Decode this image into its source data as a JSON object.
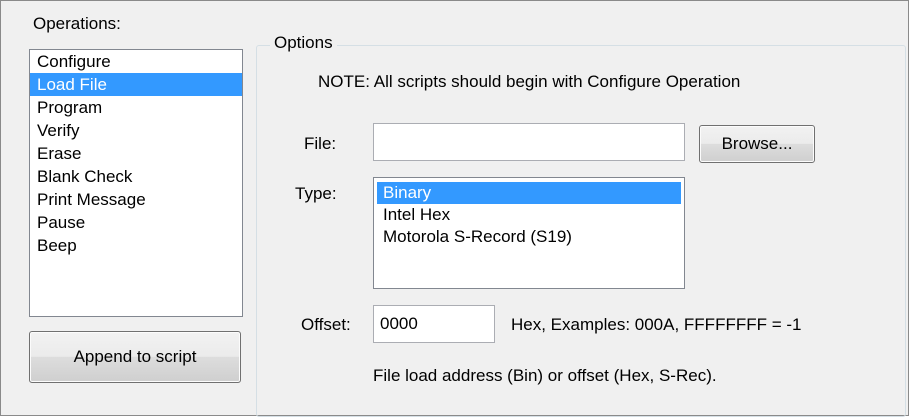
{
  "operations": {
    "label": "Operations:",
    "selected_index": 1,
    "items": [
      "Configure",
      "Load File",
      "Program",
      "Verify",
      "Erase",
      "Blank Check",
      "Print Message",
      "Pause",
      "Beep"
    ]
  },
  "append_button": "Append to script",
  "options": {
    "legend": "Options",
    "note": "NOTE: All scripts should begin with Configure Operation",
    "file_label": "File:",
    "file_value": "",
    "browse_label": "Browse...",
    "type_label": "Type:",
    "type_selected_index": 0,
    "type_items": [
      "Binary",
      "Intel Hex",
      "Motorola S-Record (S19)"
    ],
    "offset_label": "Offset:",
    "offset_value": "0000",
    "offset_hint": "Hex, Examples: 000A, FFFFFFFF = -1",
    "footer_note": "File load address (Bin) or offset (Hex, S-Rec)."
  },
  "colors": {
    "selection": "#3399ff",
    "background": "#f0f0f0"
  }
}
